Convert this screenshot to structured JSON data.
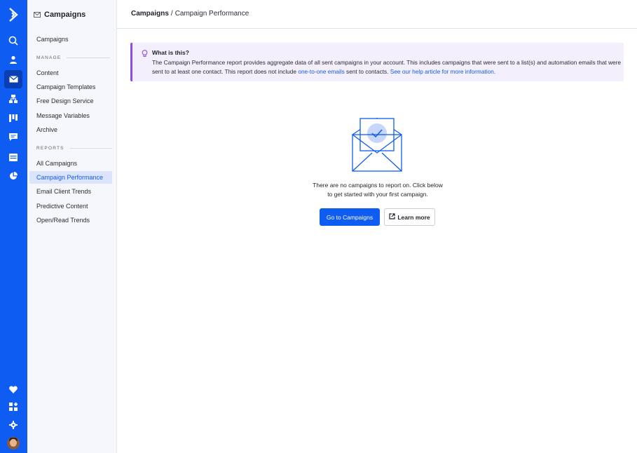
{
  "rail": {
    "icons": [
      "logo-icon",
      "search-icon",
      "contacts-icon",
      "campaigns-icon",
      "automations-icon",
      "deals-icon",
      "conversations-icon",
      "website-icon",
      "reports-icon",
      "favorites-icon",
      "apps-icon",
      "settings-icon",
      "user-avatar"
    ]
  },
  "subnav": {
    "title": "Campaigns",
    "top_item": "Campaigns",
    "manage_header": "MANAGE",
    "manage_items": [
      "Content",
      "Campaign Templates",
      "Free Design Service",
      "Message Variables",
      "Archive"
    ],
    "reports_header": "REPORTS",
    "reports_items": [
      "All Campaigns",
      "Campaign Performance",
      "Email Client Trends",
      "Predictive Content",
      "Open/Read Trends"
    ],
    "active_item": "Campaign Performance"
  },
  "breadcrumb": {
    "parent": "Campaigns",
    "separator": "/",
    "current": "Campaign Performance"
  },
  "info": {
    "title": "What is this?",
    "text_1": "The Campaign Performance report provides aggregate data of all sent campaigns in your account. This includes campaigns that were sent to a list(s) and automation emails that were sent to at least one contact. This report does not include ",
    "link_1": "one-to-one emails",
    "text_2": " sent to contacts. ",
    "link_2": "See our help article for more information."
  },
  "empty_state": {
    "line_1": "There are no campaigns to report on. Click below",
    "line_2": "to get started with your first campaign.",
    "primary_button": "Go to Campaigns",
    "secondary_button": "Learn more"
  },
  "colors": {
    "brand_blue": "#0f5cf2",
    "rail_active": "#0a3fb3",
    "info_accent": "#8b4fe6",
    "info_bg": "#f3effd"
  }
}
